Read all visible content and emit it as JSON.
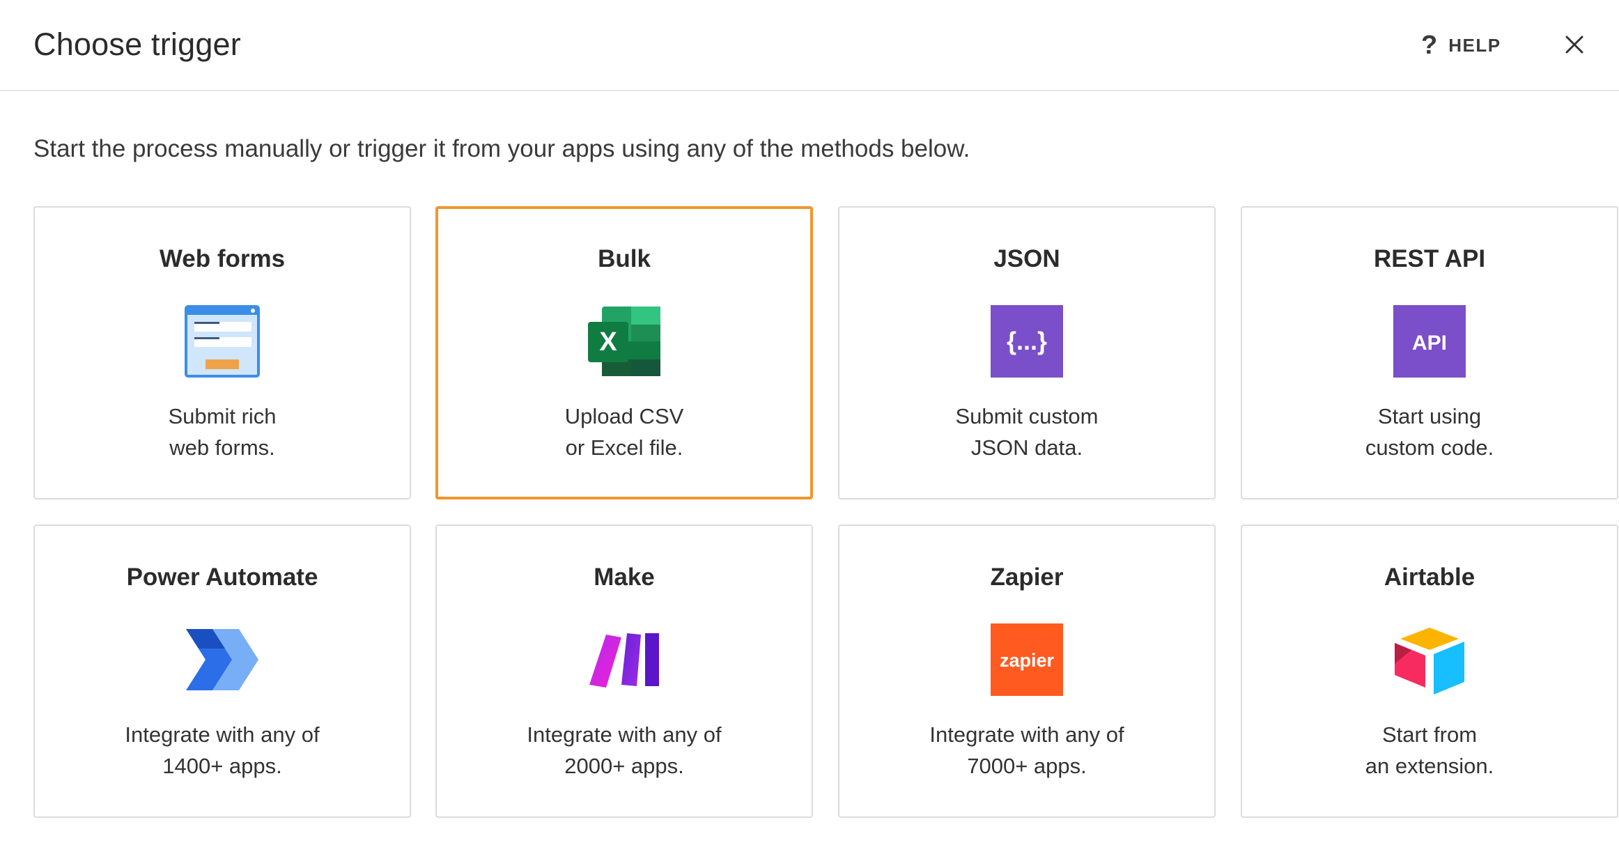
{
  "header": {
    "title": "Choose trigger",
    "help_icon": "?",
    "help_label": "HELP",
    "close_icon": "close-icon"
  },
  "subtitle": "Start the process manually or trigger it from your apps using any of the methods below.",
  "accent_color": "#f0962e",
  "cards": [
    {
      "title": "Web forms",
      "icon": "web-form-icon",
      "desc_line1": "Submit rich",
      "desc_line2": "web forms.",
      "selected": false
    },
    {
      "title": "Bulk",
      "icon": "excel-icon",
      "desc_line1": "Upload CSV",
      "desc_line2": "or Excel file.",
      "selected": true
    },
    {
      "title": "JSON",
      "icon": "json-icon",
      "icon_text": "{...}",
      "desc_line1": "Submit custom",
      "desc_line2": "JSON data.",
      "selected": false
    },
    {
      "title": "REST API",
      "icon": "api-icon",
      "icon_text": "API",
      "desc_line1": "Start using",
      "desc_line2": "custom code.",
      "selected": false
    },
    {
      "title": "Power Automate",
      "icon": "power-automate-icon",
      "desc_line1": "Integrate with any of",
      "desc_line2": "1400+ apps.",
      "selected": false
    },
    {
      "title": "Make",
      "icon": "make-icon",
      "desc_line1": "Integrate with any of",
      "desc_line2": "2000+ apps.",
      "selected": false
    },
    {
      "title": "Zapier",
      "icon": "zapier-icon",
      "icon_text": "zapier",
      "desc_line1": "Integrate with any of",
      "desc_line2": "7000+ apps.",
      "selected": false
    },
    {
      "title": "Airtable",
      "icon": "airtable-icon",
      "desc_line1": "Start from",
      "desc_line2": "an extension.",
      "selected": false
    }
  ]
}
